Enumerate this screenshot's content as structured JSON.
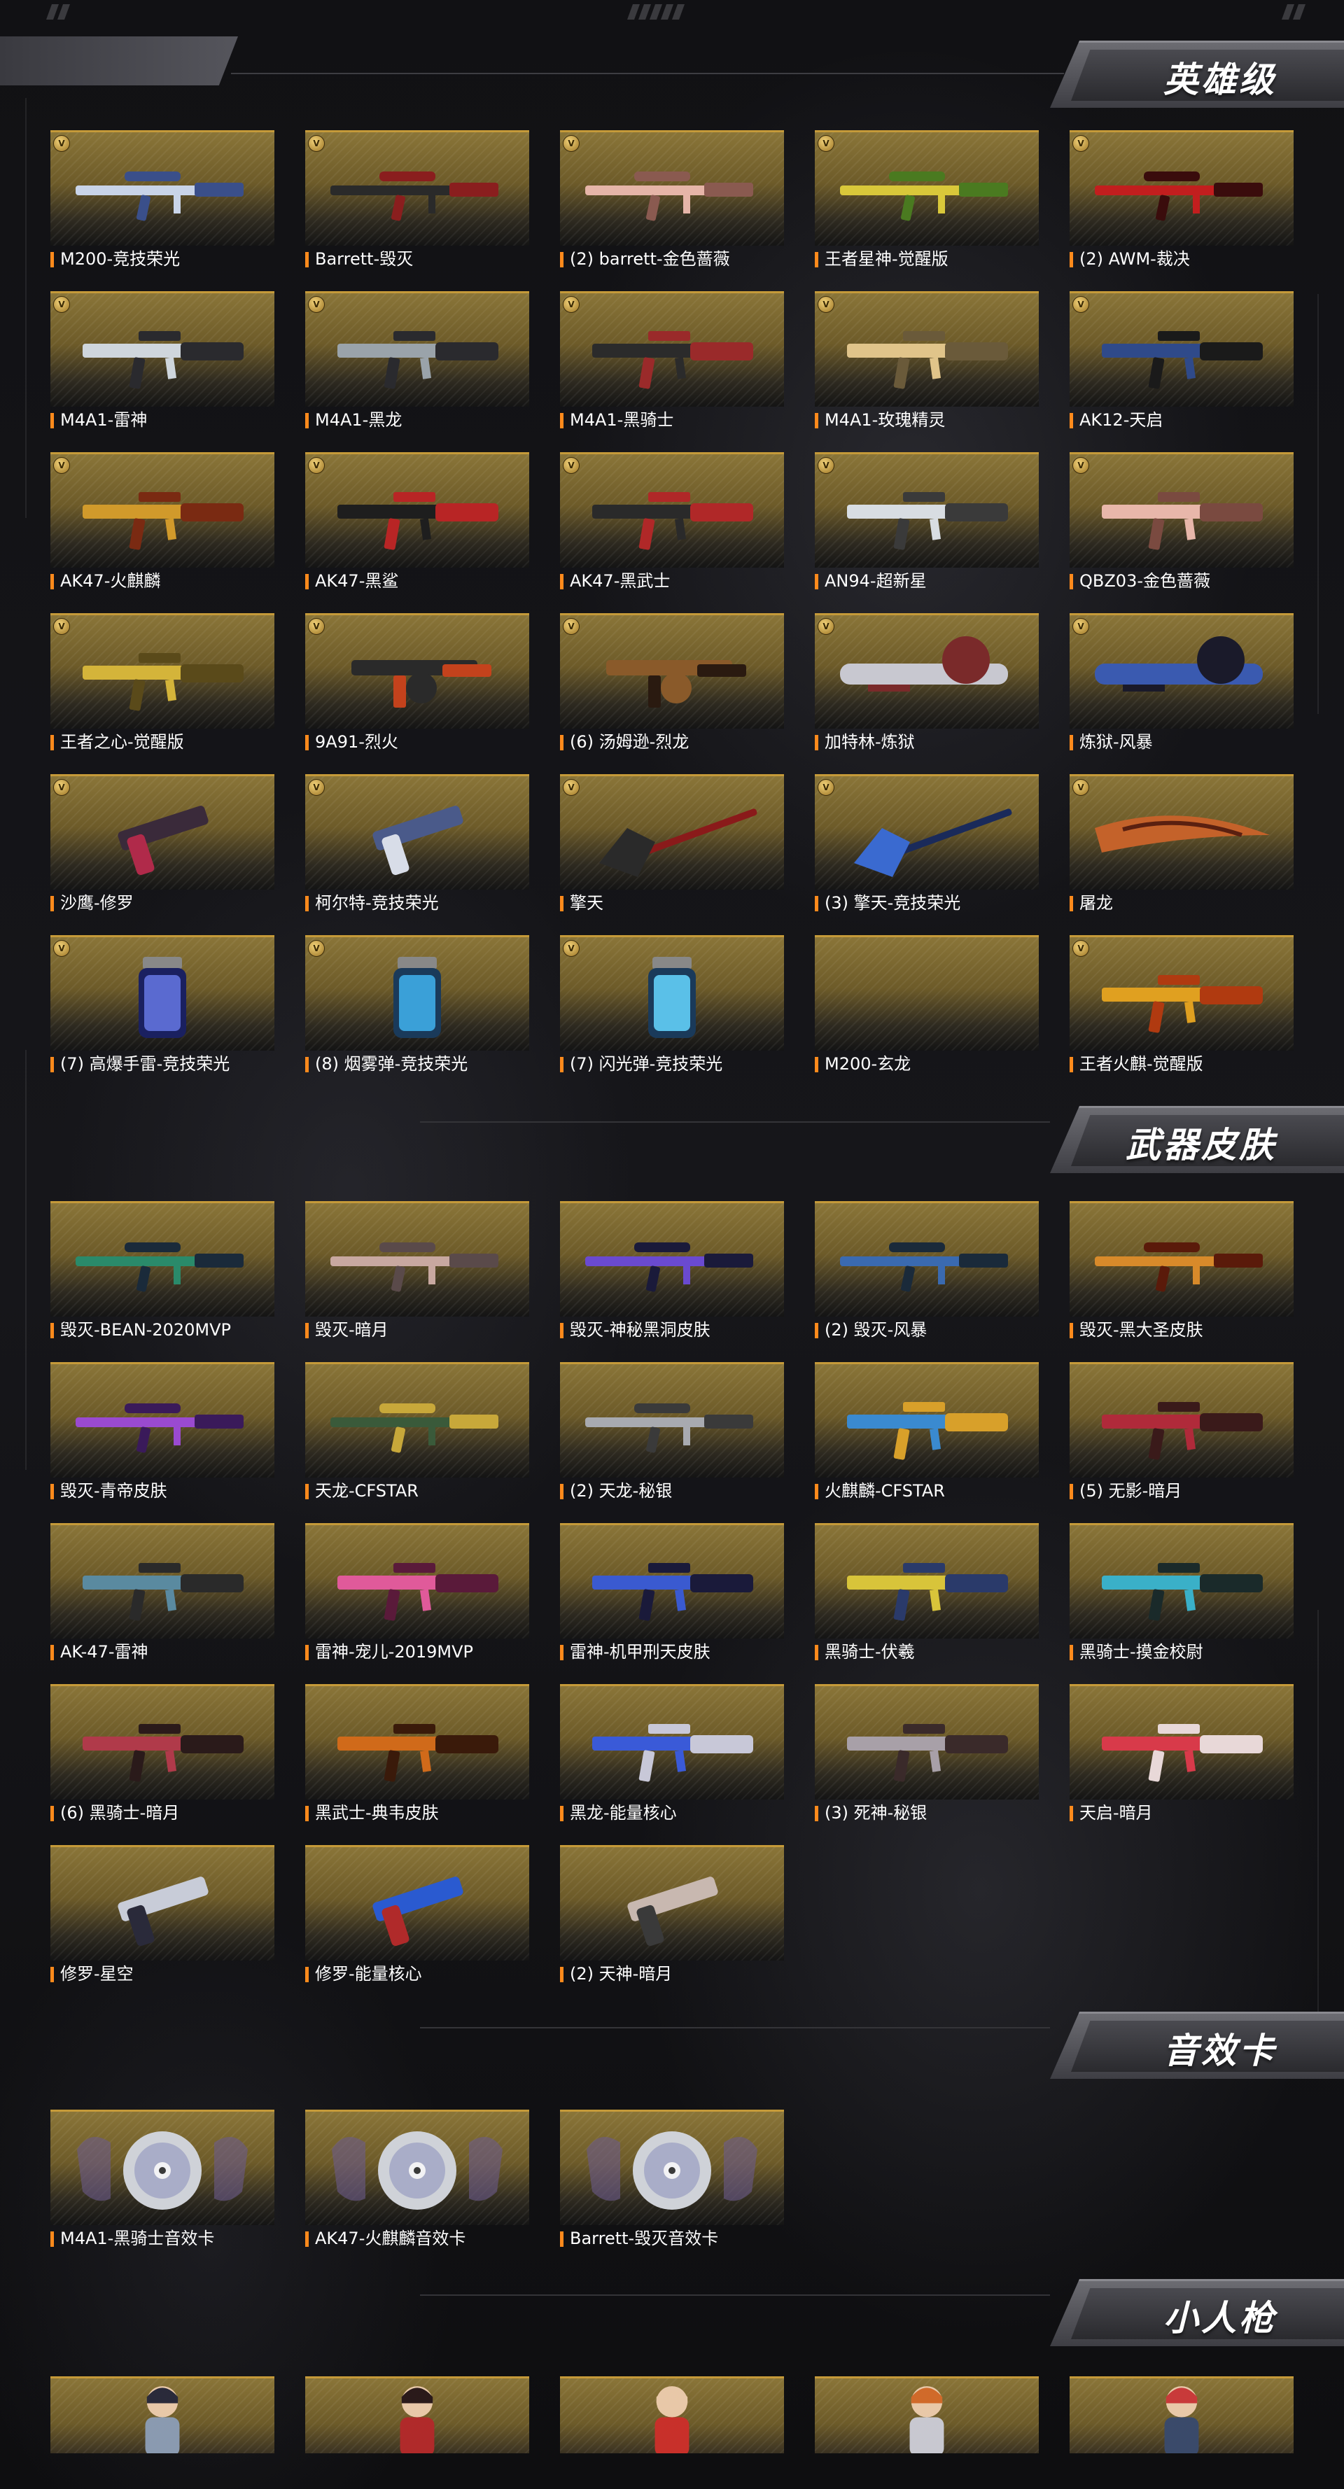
{
  "sections": {
    "heroic": {
      "title": "英雄级",
      "items": [
        {
          "label": "M200-竞技荣光",
          "badge": "V",
          "icon": "sniper-rifle",
          "colors": [
            "#c9d4e8",
            "#3a4f8a"
          ]
        },
        {
          "label": "Barrett-毁灭",
          "badge": "V",
          "icon": "sniper-rifle",
          "colors": [
            "#2a2a2a",
            "#8a1e1e"
          ]
        },
        {
          "label": "(2) barrett-金色蔷薇",
          "badge": "V",
          "icon": "sniper-rifle",
          "colors": [
            "#e6b5a8",
            "#8a5a50"
          ]
        },
        {
          "label": "王者星神-觉醒版",
          "badge": "V",
          "icon": "sniper-rifle",
          "colors": [
            "#d9c83a",
            "#4a7a20"
          ]
        },
        {
          "label": "(2) AWM-裁决",
          "badge": "V",
          "icon": "sniper-rifle",
          "colors": [
            "#c21e1e",
            "#3a0c0c"
          ]
        },
        {
          "label": "M4A1-雷神",
          "badge": "V",
          "icon": "assault-rifle",
          "colors": [
            "#cfd6dc",
            "#2a2a2e"
          ]
        },
        {
          "label": "M4A1-黑龙",
          "badge": "V",
          "icon": "assault-rifle",
          "colors": [
            "#9aa3aa",
            "#2a2a2e"
          ]
        },
        {
          "label": "M4A1-黑骑士",
          "badge": "V",
          "icon": "assault-rifle",
          "colors": [
            "#2b2b2b",
            "#9a2a2a"
          ]
        },
        {
          "label": "M4A1-玫瑰精灵",
          "badge": "V",
          "icon": "assault-rifle",
          "colors": [
            "#e0c48a",
            "#6a5a3a"
          ]
        },
        {
          "label": "AK12-天启",
          "badge": "V",
          "icon": "assault-rifle",
          "colors": [
            "#2f4a8a",
            "#1a1a1a"
          ]
        },
        {
          "label": "AK47-火麒麟",
          "badge": "V",
          "icon": "assault-rifle",
          "colors": [
            "#d19a2b",
            "#7a2a12"
          ]
        },
        {
          "label": "AK47-黑鲨",
          "badge": "V",
          "icon": "assault-rifle",
          "colors": [
            "#1e1e1e",
            "#b82525"
          ]
        },
        {
          "label": "AK47-黑武士",
          "badge": "V",
          "icon": "assault-rifle",
          "colors": [
            "#2a2a2a",
            "#b02828"
          ]
        },
        {
          "label": "AN94-超新星",
          "badge": "V",
          "icon": "assault-rifle",
          "colors": [
            "#d8dde2",
            "#3a3a3a"
          ]
        },
        {
          "label": "QBZ03-金色蔷薇",
          "badge": "V",
          "icon": "assault-rifle",
          "colors": [
            "#e8b7aa",
            "#7a4a40"
          ]
        },
        {
          "label": "王者之心-觉醒版",
          "badge": "V",
          "icon": "assault-rifle",
          "colors": [
            "#d4b43a",
            "#5a4a1a"
          ]
        },
        {
          "label": "9A91-烈火",
          "badge": "V",
          "icon": "smg",
          "colors": [
            "#2a2a2a",
            "#c4421c"
          ]
        },
        {
          "label": "(6) 汤姆逊-烈龙",
          "badge": "V",
          "icon": "smg",
          "colors": [
            "#8a5a2a",
            "#2a1a10"
          ]
        },
        {
          "label": "加特林-炼狱",
          "badge": "V",
          "icon": "gatling",
          "colors": [
            "#c8c8d0",
            "#7a2a2a"
          ]
        },
        {
          "label": "炼狱-风暴",
          "badge": "V",
          "icon": "gatling",
          "colors": [
            "#3a5ab0",
            "#1a1a2a"
          ]
        },
        {
          "label": "沙鹰-修罗",
          "badge": "V",
          "icon": "pistol",
          "colors": [
            "#3a2a3a",
            "#b02a4a"
          ]
        },
        {
          "label": "柯尔特-竞技荣光",
          "badge": "V",
          "icon": "pistol",
          "colors": [
            "#4a5a8a",
            "#d8dde8"
          ]
        },
        {
          "label": "擎天",
          "badge": "V",
          "icon": "shovel",
          "colors": [
            "#2a2a2a",
            "#8a1a1a"
          ]
        },
        {
          "label": "(3) 擎天-竞技荣光",
          "badge": "V",
          "icon": "shovel",
          "colors": [
            "#3a6ad0",
            "#1a2a5a"
          ]
        },
        {
          "label": "屠龙",
          "badge": "V",
          "icon": "blade",
          "colors": [
            "#c4622a",
            "#5a2010"
          ]
        },
        {
          "label": "(7) 高爆手雷-竞技荣光",
          "badge": "V",
          "icon": "grenade",
          "colors": [
            "#5a6ad0",
            "#1a2060"
          ]
        },
        {
          "label": "(8) 烟雾弹-竞技荣光",
          "badge": "V",
          "icon": "grenade",
          "colors": [
            "#3aa0d8",
            "#1a3a5a"
          ]
        },
        {
          "label": "(7) 闪光弹-竞技荣光",
          "badge": "V",
          "icon": "grenade",
          "colors": [
            "#5ac0e8",
            "#1a3a5a"
          ]
        },
        {
          "label": "M200-玄龙",
          "badge": "",
          "icon": "",
          "colors": [
            "#000000",
            "#000000"
          ]
        },
        {
          "label": "王者火麒-觉醒版",
          "badge": "V",
          "icon": "assault-rifle",
          "colors": [
            "#e0a020",
            "#b03a10"
          ]
        }
      ]
    },
    "skins": {
      "title": "武器皮肤",
      "items": [
        {
          "label": "毁灭-BEAN-2020MVP",
          "icon": "sniper-rifle",
          "colors": [
            "#2a8a6a",
            "#1a2a3a"
          ]
        },
        {
          "label": "毁灭-暗月",
          "icon": "sniper-rifle",
          "colors": [
            "#c8a8a0",
            "#5a4a4a"
          ]
        },
        {
          "label": "毁灭-神秘黑洞皮肤",
          "icon": "sniper-rifle",
          "colors": [
            "#6a4ad0",
            "#1a1a3a"
          ]
        },
        {
          "label": "(2) 毁灭-风暴",
          "icon": "sniper-rifle",
          "colors": [
            "#3a6ab0",
            "#1a2a3a"
          ]
        },
        {
          "label": "毁灭-黑大圣皮肤",
          "icon": "sniper-rifle",
          "colors": [
            "#d88a2a",
            "#5a1a0a"
          ]
        },
        {
          "label": "毁灭-青帝皮肤",
          "icon": "sniper-rifle",
          "colors": [
            "#9a4ad0",
            "#3a1a5a"
          ]
        },
        {
          "label": "天龙-CFSTAR",
          "icon": "sniper-rifle",
          "colors": [
            "#3a5a3a",
            "#c8a83a"
          ]
        },
        {
          "label": "(2) 天龙-秘银",
          "icon": "sniper-rifle",
          "colors": [
            "#a8aab0",
            "#3a3a3a"
          ]
        },
        {
          "label": "火麒麟-CFSTAR",
          "icon": "assault-rifle",
          "colors": [
            "#3a8ad0",
            "#d8a02a"
          ]
        },
        {
          "label": "(5) 无影-暗月",
          "icon": "assault-rifle",
          "colors": [
            "#b02a3a",
            "#3a1a1a"
          ]
        },
        {
          "label": "AK-47-雷神",
          "icon": "assault-rifle",
          "colors": [
            "#5a8aa0",
            "#2a2a2a"
          ]
        },
        {
          "label": "雷神-宠儿-2019MVP",
          "icon": "assault-rifle",
          "colors": [
            "#e05a9a",
            "#5a1a3a"
          ]
        },
        {
          "label": "雷神-机甲刑天皮肤",
          "icon": "assault-rifle",
          "colors": [
            "#3a5ad0",
            "#1a1a3a"
          ]
        },
        {
          "label": "黑骑士-伏羲",
          "icon": "assault-rifle",
          "colors": [
            "#d8c43a",
            "#2a3a6a"
          ]
        },
        {
          "label": "黑骑士-摸金校尉",
          "icon": "assault-rifle",
          "colors": [
            "#3ab0c8",
            "#1a2a2a"
          ]
        },
        {
          "label": "(6) 黑骑士-暗月",
          "icon": "assault-rifle",
          "colors": [
            "#b03a4a",
            "#2a1a1a"
          ]
        },
        {
          "label": "黑武士-典韦皮肤",
          "icon": "assault-rifle",
          "colors": [
            "#d06a1a",
            "#3a1a0a"
          ]
        },
        {
          "label": "黑龙-能量核心",
          "icon": "assault-rifle",
          "colors": [
            "#3a5ad8",
            "#c8c8d8"
          ]
        },
        {
          "label": "(3) 死神-秘银",
          "icon": "assault-rifle",
          "colors": [
            "#a8a0a8",
            "#3a2a2a"
          ]
        },
        {
          "label": "天启-暗月",
          "icon": "assault-rifle",
          "colors": [
            "#d83a4a",
            "#e8d8d8"
          ]
        },
        {
          "label": "修罗-星空",
          "icon": "pistol",
          "colors": [
            "#c8ccd8",
            "#2a2a3a"
          ]
        },
        {
          "label": "修罗-能量核心",
          "icon": "pistol",
          "colors": [
            "#2a5ad0",
            "#b02a2a"
          ]
        },
        {
          "label": "(2) 天神-暗月",
          "icon": "pistol",
          "colors": [
            "#c8b8b0",
            "#3a3a3a"
          ]
        }
      ]
    },
    "sound": {
      "title": "音效卡",
      "items": [
        {
          "label": "M4A1-黑骑士音效卡",
          "icon": "sound-disc"
        },
        {
          "label": "AK47-火麒麟音效卡",
          "icon": "sound-disc"
        },
        {
          "label": "Barrett-毁灭音效卡",
          "icon": "sound-disc"
        }
      ]
    },
    "mini": {
      "title": "小人枪",
      "items": [
        {
          "icon": "character",
          "colors": [
            "#8a9ab0",
            "#2a2a3a"
          ]
        },
        {
          "icon": "character",
          "colors": [
            "#b02a2a",
            "#2a1a1a"
          ]
        },
        {
          "icon": "character",
          "colors": [
            "#c8302a",
            "#e8c8a8"
          ]
        },
        {
          "icon": "character",
          "colors": [
            "#c8c8d0",
            "#d06a2a"
          ]
        },
        {
          "icon": "character",
          "colors": [
            "#3a4a6a",
            "#c83a3a"
          ]
        }
      ]
    }
  },
  "accent": "#ff8a1c",
  "card_border": "#c59a39"
}
